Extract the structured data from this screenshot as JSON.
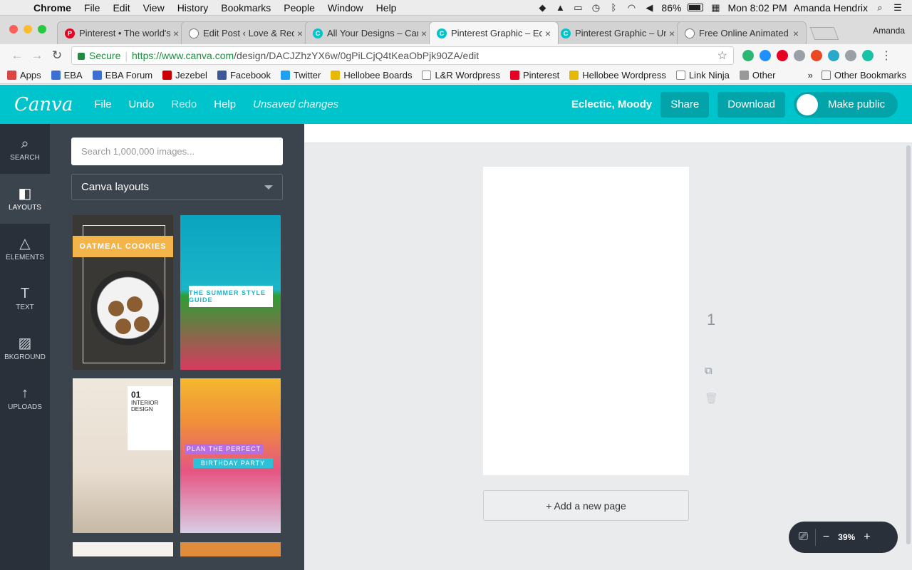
{
  "menubar": {
    "app": "Chrome",
    "items": [
      "File",
      "Edit",
      "View",
      "History",
      "Bookmarks",
      "People",
      "Window",
      "Help"
    ],
    "battery": "86%",
    "clock": "Mon 8:02 PM",
    "user": "Amanda Hendrix"
  },
  "tabs": [
    {
      "title": "Pinterest • The world's",
      "color": "#e60023",
      "glyph": "P"
    },
    {
      "title": "Edit Post ‹ Love & Red",
      "color": "#ffffff",
      "glyph": ""
    },
    {
      "title": "All Your Designs – Canva",
      "color": "#00c4cc",
      "glyph": "C"
    },
    {
      "title": "Pinterest Graphic – Eclectic",
      "color": "#00c4cc",
      "glyph": "C"
    },
    {
      "title": "Pinterest Graphic – Untitled",
      "color": "#00c4cc",
      "glyph": "C"
    },
    {
      "title": "Free Online Animated GIF",
      "color": "#ffffff",
      "glyph": ""
    }
  ],
  "active_tab_index": 3,
  "profile_name": "Amanda",
  "address": {
    "secure_label": "Secure",
    "url_host": "https://www.canva.com",
    "url_path": "/design/DACJZhzYX6w/0gPiLCjQ4tKeaObPjk90ZA/edit"
  },
  "bookmarks": [
    {
      "label": "Apps",
      "color": "#d44"
    },
    {
      "label": "EBA",
      "color": "#3b6fd4"
    },
    {
      "label": "EBA Forum",
      "color": "#3b6fd4"
    },
    {
      "label": "Jezebel",
      "color": "#c00"
    },
    {
      "label": "Facebook",
      "color": "#3b5998"
    },
    {
      "label": "Twitter",
      "color": "#1da1f2"
    },
    {
      "label": "Hellobee Boards",
      "color": "#e6b800"
    },
    {
      "label": "L&R Wordpress",
      "color": "#ffffff"
    },
    {
      "label": "Pinterest",
      "color": "#e60023"
    },
    {
      "label": "Hellobee Wordpress",
      "color": "#e6b800"
    },
    {
      "label": "Link Ninja",
      "color": "#ffffff"
    },
    {
      "label": "Other",
      "color": "#999999"
    }
  ],
  "bookmarks_more": "»",
  "bookmarks_other": "Other Bookmarks",
  "canva": {
    "logo": "Canva",
    "menu": {
      "file": "File",
      "undo": "Undo",
      "redo": "Redo",
      "help": "Help"
    },
    "unsaved": "Unsaved changes",
    "design_title": "Eclectic, Moody",
    "share": "Share",
    "download": "Download",
    "make_public": "Make public"
  },
  "rail": [
    {
      "label": "SEARCH",
      "icon": "search-icon",
      "glyph": "⌕"
    },
    {
      "label": "LAYOUTS",
      "icon": "layouts-icon",
      "glyph": "◧"
    },
    {
      "label": "ELEMENTS",
      "icon": "elements-icon",
      "glyph": "△"
    },
    {
      "label": "TEXT",
      "icon": "text-icon",
      "glyph": "T"
    },
    {
      "label": "BKGROUND",
      "icon": "background-icon",
      "glyph": "▨"
    },
    {
      "label": "UPLOADS",
      "icon": "upload-icon",
      "glyph": "↑"
    }
  ],
  "panel": {
    "search_placeholder": "Search 1,000,000 images...",
    "dropdown_value": "Canva layouts",
    "layouts": {
      "t1": "OATMEAL COOKIES",
      "t2": "THE SUMMER STYLE GUIDE",
      "t3_num": "01",
      "t3_title": "INTERIOR DESIGN",
      "t4_a": "PLAN THE PERFECT",
      "t4_b": "BIRTHDAY PARTY"
    }
  },
  "workspace": {
    "page_number": "1",
    "add_page": "+ Add a new page",
    "zoom": "39%",
    "zoom_minus": "−",
    "zoom_plus": "+"
  }
}
